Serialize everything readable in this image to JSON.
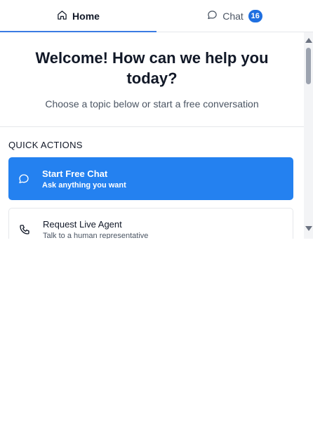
{
  "tabs": {
    "home": {
      "label": "Home",
      "icon": "home-icon"
    },
    "chat": {
      "label": "Chat",
      "icon": "chat-bubble-icon",
      "badge": "16"
    }
  },
  "hero": {
    "title": "Welcome! How can we help you today?",
    "subtitle": "Choose a topic below or start a free conversation"
  },
  "quick_actions": {
    "heading": "QUICK ACTIONS",
    "items": [
      {
        "title": "Start Free Chat",
        "subtitle": "Ask anything you want",
        "icon": "chat-bubble-icon"
      },
      {
        "title": "Request Live Agent",
        "subtitle": "Talk to a human representative",
        "icon": "phone-icon"
      }
    ]
  },
  "colors": {
    "accent": "#2481f0",
    "badge": "#1f6fe0",
    "active_tab_underline": "#3b7be3"
  }
}
